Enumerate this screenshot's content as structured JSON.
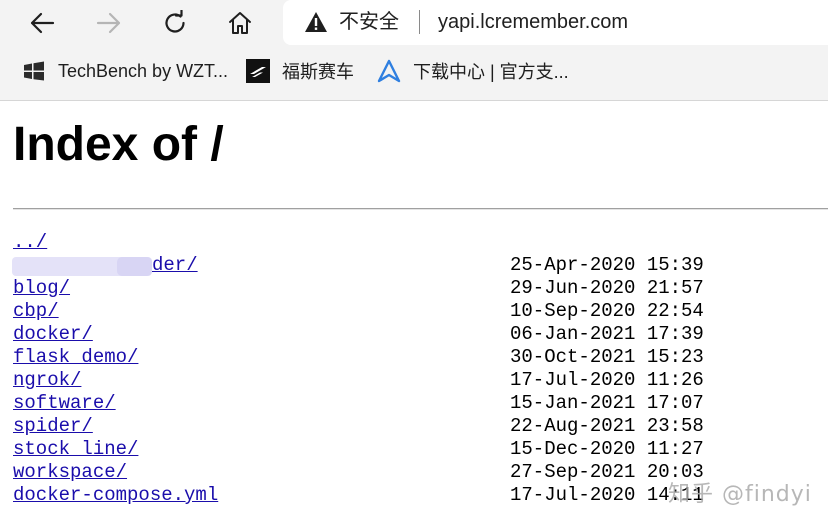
{
  "browser": {
    "security_label": "不安全",
    "url": "yapi.lcremember.com",
    "icons": {
      "back": "arrow-left-icon",
      "forward": "arrow-right-icon",
      "reload": "reload-icon",
      "home": "home-icon",
      "security": "warning-triangle-icon"
    },
    "bookmarks": [
      {
        "label": "TechBench by WZT...",
        "icon": "windows-logo-icon"
      },
      {
        "label": "福斯赛车",
        "icon": "forza-logo-icon"
      },
      {
        "label": "下载中心 | 官方支...",
        "icon": "download-center-logo-icon"
      }
    ]
  },
  "page": {
    "title": "Index of /",
    "entries": [
      {
        "name": "../",
        "date": ""
      },
      {
        "name": "der/",
        "date": "25-Apr-2020 15:39",
        "redacted": true
      },
      {
        "name": "blog/",
        "date": "29-Jun-2020 21:57"
      },
      {
        "name": "cbp/",
        "date": "10-Sep-2020 22:54"
      },
      {
        "name": "docker/",
        "date": "06-Jan-2021 17:39"
      },
      {
        "name": "flask_demo/",
        "date": "30-Oct-2021 15:23"
      },
      {
        "name": "ngrok/",
        "date": "17-Jul-2020 11:26"
      },
      {
        "name": "software/",
        "date": "15-Jan-2021 17:07"
      },
      {
        "name": "spider/",
        "date": "22-Aug-2021 23:58"
      },
      {
        "name": "stock_line/",
        "date": "15-Dec-2020 11:27"
      },
      {
        "name": "workspace/",
        "date": "27-Sep-2021 20:03"
      },
      {
        "name": "docker-compose.yml",
        "date": "17-Jul-2020 14:11"
      }
    ]
  },
  "watermark": "知乎 @findyi",
  "colors": {
    "link": "#1a0dab",
    "chrome_bg": "#f3f3f3",
    "redaction": "#e4e2f8"
  }
}
